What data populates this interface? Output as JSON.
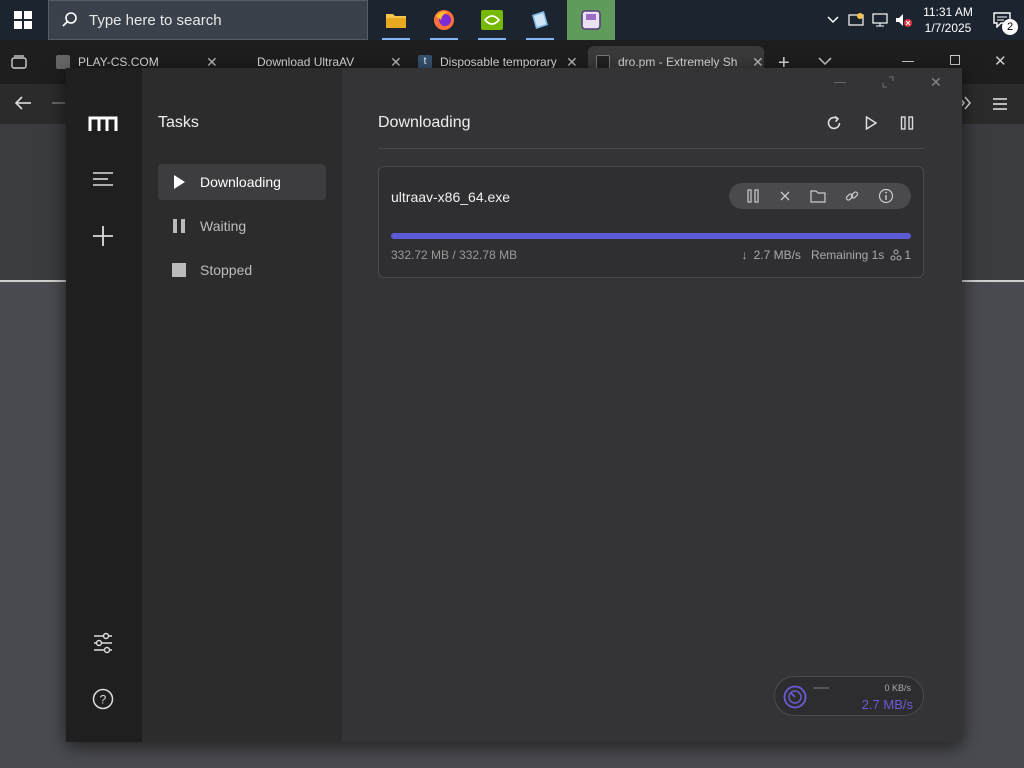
{
  "taskbar": {
    "search_placeholder": "Type here to search",
    "time": "11:31 AM",
    "date": "1/7/2025",
    "notification_count": "2"
  },
  "browser": {
    "tabs": [
      {
        "title": "PLAY-CS.COM"
      },
      {
        "title": "Download UltraAV"
      },
      {
        "title": "Disposable temporary"
      },
      {
        "title": "dro.pm - Extremely Sh"
      }
    ]
  },
  "app": {
    "nav_title": "Tasks",
    "nav_items": [
      {
        "label": "Downloading"
      },
      {
        "label": "Waiting"
      },
      {
        "label": "Stopped"
      }
    ],
    "main_title": "Downloading",
    "task": {
      "filename": "ultraav-x86_64.exe",
      "progress_text": "332.72 MB / 332.78 MB",
      "progress_fraction": 0.9998,
      "speed": "2.7 MB/s",
      "remaining": "Remaining 1s",
      "connections": "1"
    },
    "speedmeter": {
      "upload": "0 KB/s",
      "download": "2.7 MB/s"
    },
    "accent_color": "#5b5bd6"
  }
}
